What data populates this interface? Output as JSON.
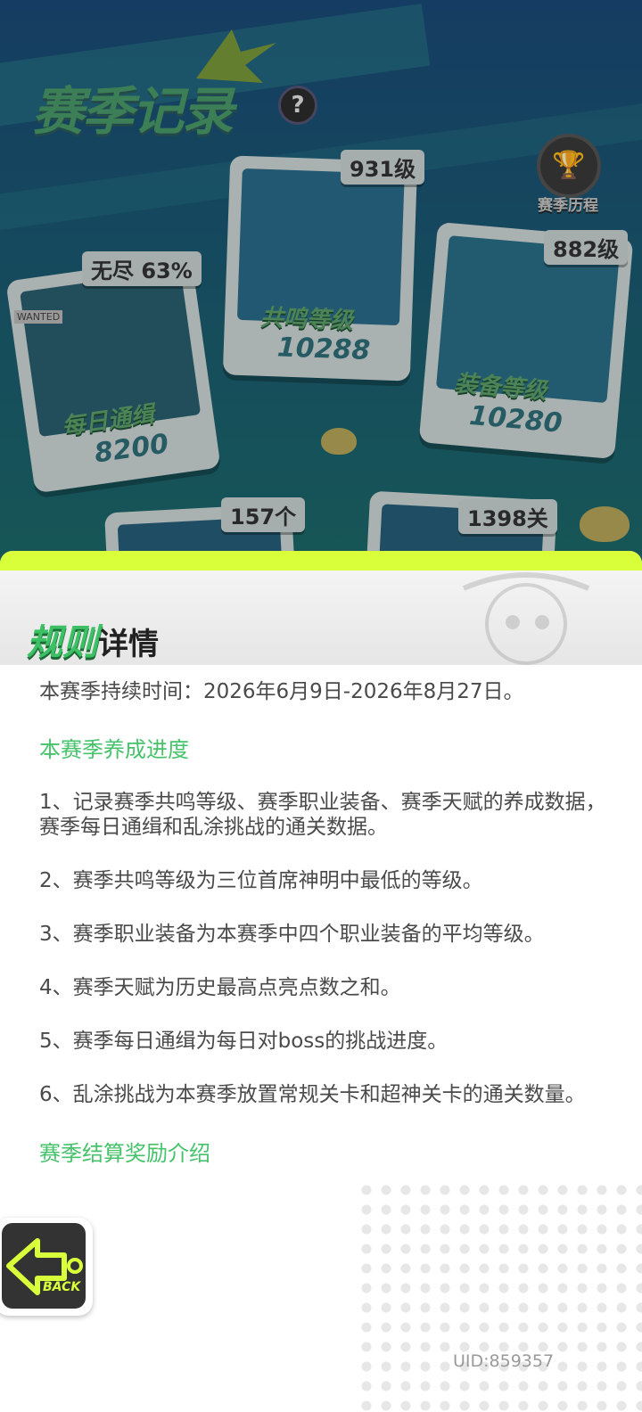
{
  "season_record": {
    "title": "赛季记录",
    "help_icon_glyph": "?",
    "journey_label": "赛季历程",
    "cards": [
      {
        "id": "daily",
        "label": "每日通缉",
        "value": "8200",
        "tag": "无尽 63%"
      },
      {
        "id": "resonance",
        "label": "共鸣等级",
        "value": "10288",
        "tag": "931级"
      },
      {
        "id": "equipment",
        "label": "装备等级",
        "value": "10280",
        "tag": "882级"
      },
      {
        "id": "talent",
        "tag": "157个"
      },
      {
        "id": "graffiti",
        "tag": "1398关"
      }
    ],
    "wanted_label": "WANTED"
  },
  "rules_panel": {
    "title_highlight": "规则",
    "title_rest": "详情",
    "duration_text": "本赛季持续时间：2026年6月9日-2026年8月27日。",
    "section1_heading": "本赛季养成进度",
    "rules": [
      "1、记录赛季共鸣等级、赛季职业装备、赛季天赋的养成数据，赛季每日通缉和乱涂挑战的通关数据。",
      "2、赛季共鸣等级为三位首席神明中最低的等级。",
      "3、赛季职业装备为本赛季中四个职业装备的平均等级。",
      "4、赛季天赋为历史最高点亮点数之和。",
      "5、赛季每日通缉为每日对boss的挑战进度。",
      "6、乱涂挑战为本赛季放置常规关卡和超神关卡的通关数量。"
    ],
    "section2_heading": "赛季结算奖励介绍"
  },
  "back_button": {
    "label": "BACK"
  },
  "footer": {
    "uid": "UID:859357"
  },
  "colors": {
    "accent_green": "#46c26b",
    "slime_yellow": "#d9ff3a"
  }
}
